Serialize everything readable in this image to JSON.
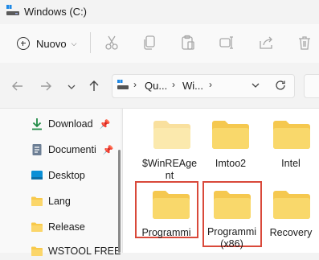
{
  "window": {
    "title": "Windows (C:)"
  },
  "toolbar": {
    "new_label": "Nuovo",
    "icons": [
      "cut-icon",
      "copy-icon",
      "paste-icon",
      "rename-icon",
      "share-icon",
      "delete-icon"
    ]
  },
  "navigation": {
    "breadcrumb": [
      "Qu...",
      "Wi..."
    ]
  },
  "sidebar": {
    "items": [
      {
        "label": "Download",
        "icon": "download-icon",
        "pinned": true
      },
      {
        "label": "Documenti",
        "icon": "documents-icon",
        "pinned": true
      },
      {
        "label": "Desktop",
        "icon": "desktop-icon",
        "pinned": false
      },
      {
        "label": "Lang",
        "icon": "folder-icon",
        "pinned": false
      },
      {
        "label": "Release",
        "icon": "folder-icon",
        "pinned": false
      },
      {
        "label": "WSTOOL FREE",
        "icon": "folder-icon",
        "pinned": false
      }
    ]
  },
  "folders": [
    {
      "name": "$WinREAgent",
      "line1": "$WinREAge",
      "line2": "nt",
      "faded": true
    },
    {
      "name": "Imtoo2",
      "line1": "Imtoo2",
      "line2": "",
      "faded": false
    },
    {
      "name": "Intel",
      "line1": "Intel",
      "line2": "",
      "faded": false
    },
    {
      "name": "Programmi",
      "line1": "Programmi",
      "line2": "",
      "faded": false,
      "highlighted": true
    },
    {
      "name": "Programmi (x86)",
      "line1": "Programmi",
      "line2": "(x86)",
      "faded": false,
      "highlighted": true
    },
    {
      "name": "Recovery",
      "line1": "Recovery",
      "line2": "",
      "faded": false
    }
  ],
  "colors": {
    "folder": "#f8c94a",
    "folder_faded": "#f7e3ae",
    "highlight": "#d9493a",
    "accent": "#1f7a3a"
  }
}
